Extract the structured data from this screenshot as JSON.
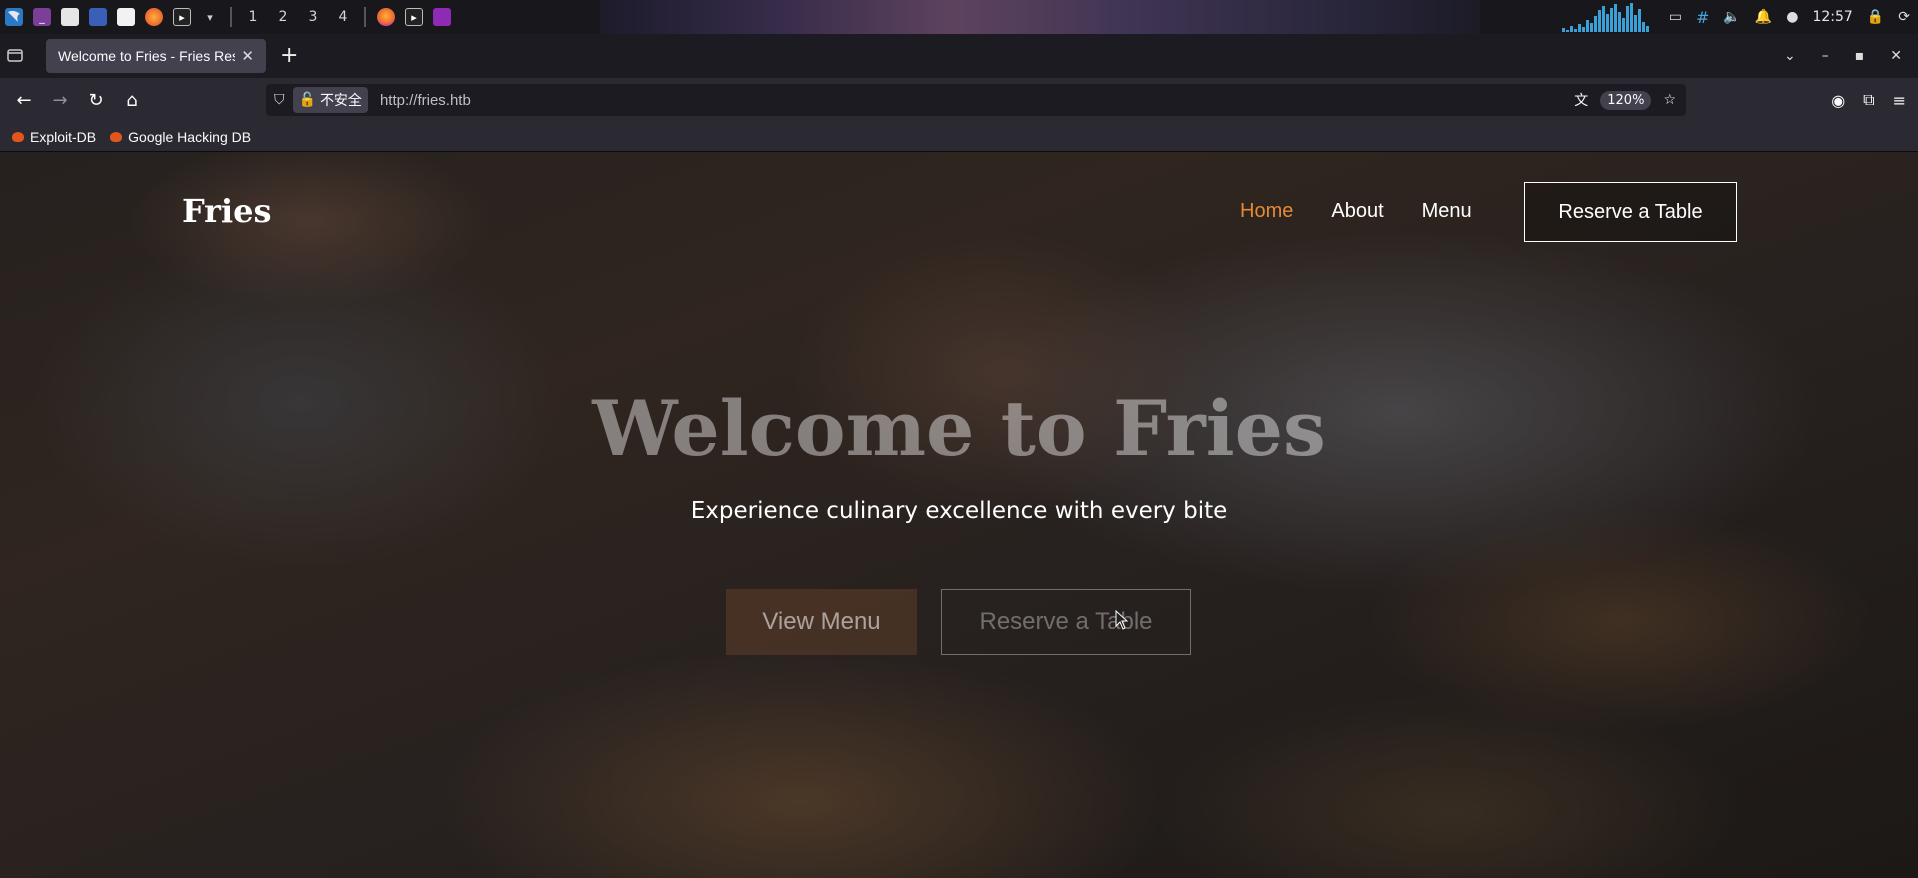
{
  "taskbar": {
    "workspaces": [
      "1",
      "2",
      "3",
      "4"
    ],
    "clock": "12:57",
    "icons": [
      "kali-menu-icon",
      "terminal-app-icon",
      "file-manager-icon",
      "screenshot-icon",
      "document-icon",
      "firefox-icon",
      "terminal-icon",
      "firefox-window-icon",
      "terminal-window-icon",
      "folder-window-icon"
    ],
    "tray_icons": [
      "audio-visualizer",
      "screen-icon",
      "network-icon",
      "volume-icon",
      "bell-icon",
      "update-icon",
      "lock-icon",
      "power-icon"
    ]
  },
  "browser": {
    "tab_title": "Welcome to Fries - Fries Restaurant",
    "url": "http://fries.htb",
    "security_label": "不安全",
    "zoom": "120%",
    "bookmarks": [
      {
        "label": "Exploit-DB"
      },
      {
        "label": "Google Hacking DB"
      }
    ]
  },
  "site": {
    "logo": "Fries",
    "nav": [
      {
        "label": "Home",
        "active": true
      },
      {
        "label": "About",
        "active": false
      },
      {
        "label": "Menu",
        "active": false
      }
    ],
    "reserve_button": "Reserve a Table",
    "hero": {
      "title": "Welcome to Fries",
      "subtitle": "Experience culinary excellence with every bite",
      "primary_button": "View Menu",
      "secondary_button": "Reserve a Table"
    },
    "accent_color": "#e38a37"
  }
}
